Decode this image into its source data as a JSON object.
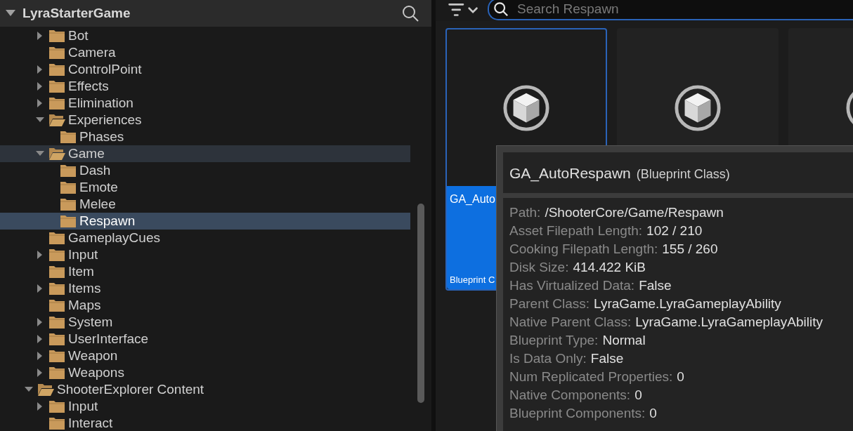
{
  "sidebar": {
    "title": "LyraStarterGame",
    "expanded": true,
    "tree": [
      {
        "children": [
          {
            "label": "Bot",
            "expandable": true,
            "expanded": false,
            "selected": false,
            "highlighted": false
          },
          {
            "label": "Camera",
            "expandable": false,
            "expanded": false,
            "selected": false,
            "highlighted": false
          },
          {
            "label": "ControlPoint",
            "expandable": true,
            "expanded": false,
            "selected": false,
            "highlighted": false
          },
          {
            "label": "Effects",
            "expandable": true,
            "expanded": false,
            "selected": false,
            "highlighted": false
          },
          {
            "label": "Elimination",
            "expandable": true,
            "expanded": false,
            "selected": false,
            "highlighted": false
          },
          {
            "label": "Experiences",
            "expandable": true,
            "expanded": true,
            "selected": false,
            "highlighted": false,
            "children": [
              {
                "label": "Phases",
                "expandable": false,
                "expanded": false,
                "selected": false,
                "highlighted": false
              }
            ]
          },
          {
            "label": "Game",
            "expandable": true,
            "expanded": true,
            "selected": false,
            "highlighted": true,
            "children": [
              {
                "label": "Dash",
                "expandable": false,
                "expanded": false,
                "selected": false,
                "highlighted": false
              },
              {
                "label": "Emote",
                "expandable": false,
                "expanded": false,
                "selected": false,
                "highlighted": false
              },
              {
                "label": "Melee",
                "expandable": false,
                "expanded": false,
                "selected": false,
                "highlighted": false
              },
              {
                "label": "Respawn",
                "expandable": false,
                "expanded": false,
                "selected": true,
                "highlighted": false
              }
            ]
          },
          {
            "label": "GameplayCues",
            "expandable": false,
            "expanded": false,
            "selected": false,
            "highlighted": false
          },
          {
            "label": "Input",
            "expandable": true,
            "expanded": false,
            "selected": false,
            "highlighted": false
          },
          {
            "label": "Item",
            "expandable": false,
            "expanded": false,
            "selected": false,
            "highlighted": false
          },
          {
            "label": "Items",
            "expandable": true,
            "expanded": false,
            "selected": false,
            "highlighted": false
          },
          {
            "label": "Maps",
            "expandable": false,
            "expanded": false,
            "selected": false,
            "highlighted": false
          },
          {
            "label": "System",
            "expandable": true,
            "expanded": false,
            "selected": false,
            "highlighted": false
          },
          {
            "label": "UserInterface",
            "expandable": true,
            "expanded": false,
            "selected": false,
            "highlighted": false
          },
          {
            "label": "Weapon",
            "expandable": true,
            "expanded": false,
            "selected": false,
            "highlighted": false
          },
          {
            "label": "Weapons",
            "expandable": true,
            "expanded": false,
            "selected": false,
            "highlighted": false
          }
        ]
      },
      {
        "label": "ShooterExplorer Content",
        "expandable": true,
        "expanded": true,
        "selected": false,
        "highlighted": false,
        "children": [
          {
            "label": "Input",
            "expandable": true,
            "expanded": false,
            "selected": false,
            "highlighted": false
          },
          {
            "label": "Interact",
            "expandable": false,
            "expanded": false,
            "selected": false,
            "highlighted": false
          }
        ]
      }
    ]
  },
  "search": {
    "placeholder": "Search Respawn"
  },
  "assets": [
    {
      "name": "GA_Auto",
      "type": "Blueprint C",
      "selected": true
    },
    {
      "selected": false
    },
    {
      "selected": false
    }
  ],
  "tooltip": {
    "title": "GA_AutoRespawn",
    "subtitle": "(Blueprint Class)",
    "rows": [
      {
        "label": "Path:",
        "value": "/ShooterCore/Game/Respawn"
      },
      {
        "label": "Asset Filepath Length:",
        "value": "102 / 210"
      },
      {
        "label": "Cooking Filepath Length:",
        "value": "155 / 260"
      },
      {
        "label": "Disk Size:",
        "value": "414.422 KiB"
      },
      {
        "label": "Has Virtualized Data:",
        "value": "False"
      },
      {
        "label": "Parent Class:",
        "value": "LyraGame.LyraGameplayAbility"
      },
      {
        "label": "Native Parent Class:",
        "value": "LyraGame.LyraGameplayAbility"
      },
      {
        "label": "Blueprint Type:",
        "value": "Normal"
      },
      {
        "label": "Is Data Only:",
        "value": "False"
      },
      {
        "label": "Num Replicated Properties:",
        "value": "0"
      },
      {
        "label": "Native Components:",
        "value": "0"
      },
      {
        "label": "Blueprint Components:",
        "value": "0"
      }
    ]
  }
}
